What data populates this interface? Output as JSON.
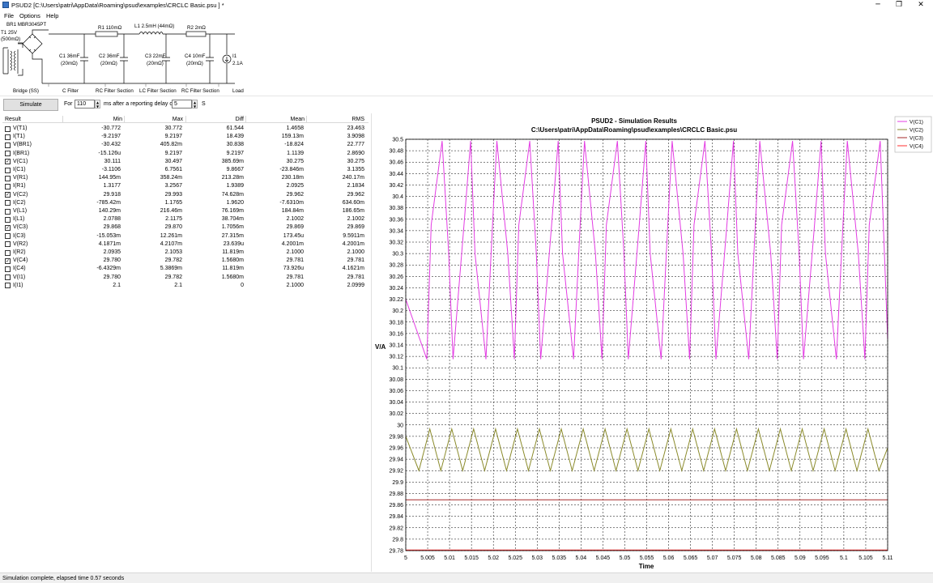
{
  "window": {
    "title": "PSUD2  [C:\\Users\\patri\\AppData\\Roaming\\psud\\examples\\CRCLC Basic.psu ] *",
    "minimize_glyph": "─",
    "maximize_glyph": "❐",
    "close_glyph": "✕"
  },
  "menu": {
    "file": "File",
    "options": "Options",
    "help": "Help"
  },
  "schematic": {
    "rectifier": "BR1 MBR3045PT",
    "transformer_1": "T1 25V",
    "transformer_2": "(500mΩ)",
    "r1": "R1 110mΩ",
    "l1": "L1 2.5mH (44mΩ)",
    "r2": "R2 2mΩ",
    "c1_1": "C1 36mF",
    "c1_2": "(20mΩ)",
    "c2_1": "C2 36mF",
    "c2_2": "(20mΩ)",
    "c3_1": "C3 22mF",
    "c3_2": "(20mΩ)",
    "c4_1": "C4 10mF",
    "c4_2": "(20mΩ)",
    "i1_1": "I1",
    "i1_2": "2.1A",
    "sec_bridge": "Bridge (SS)",
    "sec_cfilter": "C Filter",
    "sec_rc1": "RC Filter Section",
    "sec_lc": "LC Filter Section",
    "sec_rc2": "RC Filter Section",
    "sec_load": "Load"
  },
  "toolbar": {
    "simulate": "Simulate",
    "for_label": "For",
    "for_value": "110",
    "ms_label": "ms  after a reporting delay of",
    "delay_value": "5",
    "s_label": "S",
    "arrow_up": "▲",
    "arrow_down": "▼"
  },
  "results": {
    "columns": [
      "Result",
      "Min",
      "Max",
      "Diff",
      "Mean",
      "RMS"
    ],
    "check_glyph": "✓",
    "rows": [
      {
        "name": "V(T1)",
        "checked": false,
        "min": "-30.772",
        "max": "30.772",
        "diff": "61.544",
        "mean": "1.4658",
        "rms": "23.463"
      },
      {
        "name": "I(T1)",
        "checked": false,
        "min": "-9.2197",
        "max": "9.2197",
        "diff": "18.439",
        "mean": "159.13m",
        "rms": "3.9098"
      },
      {
        "name": "V(BR1)",
        "checked": false,
        "min": "-30.432",
        "max": "405.82m",
        "diff": "30.838",
        "mean": "-18.824",
        "rms": "22.777"
      },
      {
        "name": "I(BR1)",
        "checked": false,
        "min": "-15.126u",
        "max": "9.2197",
        "diff": "9.2197",
        "mean": "1.1139",
        "rms": "2.8690"
      },
      {
        "name": "V(C1)",
        "checked": true,
        "min": "30.111",
        "max": "30.497",
        "diff": "385.69m",
        "mean": "30.275",
        "rms": "30.275"
      },
      {
        "name": "I(C1)",
        "checked": false,
        "min": "-3.1106",
        "max": "6.7561",
        "diff": "9.8667",
        "mean": "-23.846m",
        "rms": "3.1355"
      },
      {
        "name": "V(R1)",
        "checked": false,
        "min": "144.95m",
        "max": "358.24m",
        "diff": "213.28m",
        "mean": "230.18m",
        "rms": "240.17m"
      },
      {
        "name": "I(R1)",
        "checked": false,
        "min": "1.3177",
        "max": "3.2567",
        "diff": "1.9389",
        "mean": "2.0925",
        "rms": "2.1834"
      },
      {
        "name": "V(C2)",
        "checked": true,
        "min": "29.918",
        "max": "29.993",
        "diff": "74.628m",
        "mean": "29.962",
        "rms": "29.962"
      },
      {
        "name": "I(C2)",
        "checked": false,
        "min": "-785.42m",
        "max": "1.1765",
        "diff": "1.9620",
        "mean": "-7.6310m",
        "rms": "634.60m"
      },
      {
        "name": "V(L1)",
        "checked": false,
        "min": "140.29m",
        "max": "216.46m",
        "diff": "76.169m",
        "mean": "184.84m",
        "rms": "186.65m"
      },
      {
        "name": "I(L1)",
        "checked": false,
        "min": "2.0788",
        "max": "2.1175",
        "diff": "38.704m",
        "mean": "2.1002",
        "rms": "2.1002"
      },
      {
        "name": "V(C3)",
        "checked": true,
        "min": "29.868",
        "max": "29.870",
        "diff": "1.7056m",
        "mean": "29.869",
        "rms": "29.869"
      },
      {
        "name": "I(C3)",
        "checked": false,
        "min": "-15.053m",
        "max": "12.261m",
        "diff": "27.315m",
        "mean": "173.45u",
        "rms": "9.5911m"
      },
      {
        "name": "V(R2)",
        "checked": false,
        "min": "4.1871m",
        "max": "4.2107m",
        "diff": "23.639u",
        "mean": "4.2001m",
        "rms": "4.2001m"
      },
      {
        "name": "I(R2)",
        "checked": false,
        "min": "2.0935",
        "max": "2.1053",
        "diff": "11.819m",
        "mean": "2.1000",
        "rms": "2.1000"
      },
      {
        "name": "V(C4)",
        "checked": true,
        "min": "29.780",
        "max": "29.782",
        "diff": "1.5680m",
        "mean": "29.781",
        "rms": "29.781"
      },
      {
        "name": "I(C4)",
        "checked": false,
        "min": "-6.4329m",
        "max": "5.3869m",
        "diff": "11.819m",
        "mean": "73.926u",
        "rms": "4.1621m"
      },
      {
        "name": "V(I1)",
        "checked": false,
        "min": "29.780",
        "max": "29.782",
        "diff": "1.5680m",
        "mean": "29.781",
        "rms": "29.781"
      },
      {
        "name": "I(I1)",
        "checked": false,
        "min": "2.1",
        "max": "2.1",
        "diff": "0",
        "mean": "2.1000",
        "rms": "2.0999"
      }
    ]
  },
  "status": {
    "text": "Simulation complete, elapsed time 0.57 seconds"
  },
  "colors": {
    "vc1": "#e33ce3",
    "vc2": "#8a8a2a",
    "vc3": "#a52a2a",
    "vc4": "#ff3030"
  },
  "chart_data": {
    "type": "line",
    "title": "PSUD2 - Simulation Results",
    "subtitle": "C:\\Users\\patri\\AppData\\Roaming\\psud\\examples\\CRCLC Basic.psu",
    "xlabel": "Time",
    "ylabel": "V/A",
    "xlim": [
      5,
      5.11
    ],
    "ylim": [
      29.78,
      30.5
    ],
    "x_ticks": [
      "5",
      "5.005",
      "5.01",
      "5.015",
      "5.02",
      "5.025",
      "5.03",
      "5.035",
      "5.04",
      "5.045",
      "5.05",
      "5.055",
      "5.06",
      "5.065",
      "5.07",
      "5.075",
      "5.08",
      "5.085",
      "5.09",
      "5.095",
      "5.1",
      "5.105",
      "5.11"
    ],
    "y_ticks": [
      "29.78",
      "29.8",
      "29.82",
      "29.84",
      "29.86",
      "29.88",
      "29.9",
      "29.92",
      "29.94",
      "29.96",
      "29.98",
      "30",
      "30.02",
      "30.04",
      "30.06",
      "30.08",
      "30.1",
      "30.12",
      "30.14",
      "30.16",
      "30.18",
      "30.2",
      "30.22",
      "30.24",
      "30.26",
      "30.28",
      "30.3",
      "30.32",
      "30.34",
      "30.36",
      "30.38",
      "30.4",
      "30.42",
      "30.44",
      "30.46",
      "30.48",
      "30.5"
    ],
    "grid": true,
    "legend": "top-right",
    "series": [
      {
        "name": "V(C1)",
        "color": "#e33ce3",
        "min": 30.111,
        "max": 30.497,
        "x": [
          5.0,
          5.0048,
          5.0058,
          5.0083,
          5.0098,
          5.0108,
          5.0133,
          5.0148,
          5.0158,
          5.0183,
          5.0198,
          5.0208,
          5.0233,
          5.0248,
          5.0258,
          5.0283,
          5.0298,
          5.0308,
          5.0333,
          5.0348,
          5.0358,
          5.0383,
          5.0398,
          5.0408,
          5.0433,
          5.0448,
          5.0458,
          5.0483,
          5.0498,
          5.0508,
          5.0533,
          5.0548,
          5.0558,
          5.0583,
          5.0598,
          5.0608,
          5.0633,
          5.0648,
          5.0658,
          5.0683,
          5.0698,
          5.0708,
          5.0733,
          5.0748,
          5.0758,
          5.0783,
          5.0798,
          5.0808,
          5.0833,
          5.0848,
          5.0858,
          5.0883,
          5.0898,
          5.0908,
          5.0933,
          5.0948,
          5.0958,
          5.0983,
          5.0998,
          5.1008,
          5.1033,
          5.1048,
          5.1058,
          5.1083,
          5.11
        ],
        "y": [
          30.22,
          30.115,
          30.35,
          30.497,
          30.3,
          30.115,
          30.35,
          30.497,
          30.3,
          30.115,
          30.35,
          30.497,
          30.3,
          30.115,
          30.35,
          30.497,
          30.3,
          30.115,
          30.35,
          30.497,
          30.3,
          30.115,
          30.35,
          30.497,
          30.3,
          30.115,
          30.35,
          30.497,
          30.3,
          30.115,
          30.35,
          30.497,
          30.3,
          30.115,
          30.35,
          30.497,
          30.3,
          30.115,
          30.35,
          30.497,
          30.3,
          30.115,
          30.35,
          30.497,
          30.3,
          30.115,
          30.35,
          30.497,
          30.3,
          30.115,
          30.35,
          30.497,
          30.3,
          30.115,
          30.35,
          30.497,
          30.3,
          30.115,
          30.35,
          30.497,
          30.3,
          30.115,
          30.35,
          30.497,
          30.15
        ]
      },
      {
        "name": "V(C2)",
        "color": "#8a8a2a",
        "min": 29.918,
        "max": 29.993,
        "x": [
          5.0,
          5.003,
          5.0055,
          5.008,
          5.0105,
          5.013,
          5.0155,
          5.018,
          5.0205,
          5.023,
          5.0255,
          5.028,
          5.0305,
          5.033,
          5.0355,
          5.038,
          5.0405,
          5.043,
          5.0455,
          5.048,
          5.0505,
          5.053,
          5.0555,
          5.058,
          5.0605,
          5.063,
          5.0655,
          5.068,
          5.0705,
          5.073,
          5.0755,
          5.078,
          5.0805,
          5.083,
          5.0855,
          5.088,
          5.0905,
          5.093,
          5.0955,
          5.098,
          5.1005,
          5.103,
          5.1055,
          5.108,
          5.11
        ],
        "y": [
          29.98,
          29.92,
          29.993,
          29.92,
          29.993,
          29.92,
          29.993,
          29.92,
          29.993,
          29.92,
          29.993,
          29.92,
          29.993,
          29.92,
          29.993,
          29.92,
          29.993,
          29.92,
          29.993,
          29.92,
          29.993,
          29.92,
          29.993,
          29.92,
          29.993,
          29.92,
          29.993,
          29.92,
          29.993,
          29.92,
          29.993,
          29.92,
          29.993,
          29.92,
          29.993,
          29.92,
          29.993,
          29.92,
          29.993,
          29.92,
          29.993,
          29.92,
          29.993,
          29.92,
          29.96
        ]
      },
      {
        "name": "V(C3)",
        "color": "#a52a2a",
        "min": 29.868,
        "max": 29.87,
        "x": [
          5.0,
          5.11
        ],
        "y": [
          29.869,
          29.869
        ]
      },
      {
        "name": "V(C4)",
        "color": "#ff3030",
        "min": 29.78,
        "max": 29.782,
        "x": [
          5.0,
          5.11
        ],
        "y": [
          29.781,
          29.781
        ]
      }
    ]
  }
}
